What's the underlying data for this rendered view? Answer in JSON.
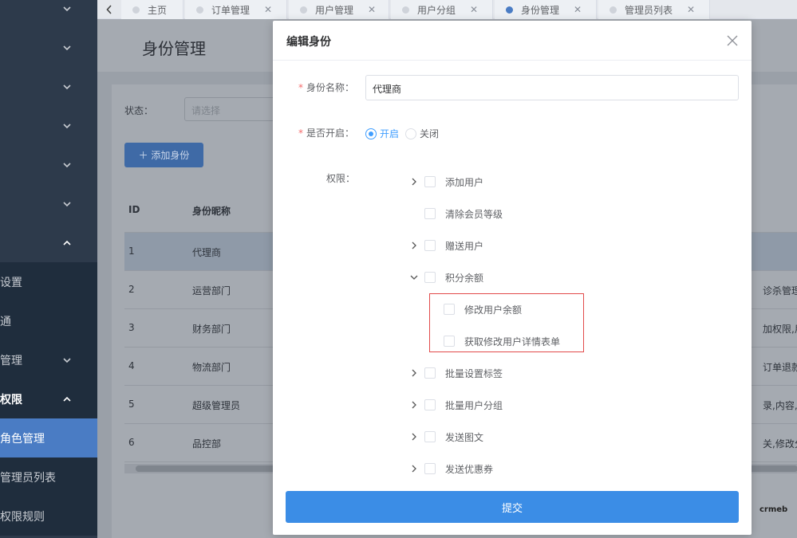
{
  "sidebar": {
    "items": [
      {
        "label": "",
        "expanded": false
      },
      {
        "label": "",
        "expanded": false
      },
      {
        "label": "",
        "expanded": false
      },
      {
        "label": "",
        "expanded": false
      },
      {
        "label": "",
        "expanded": false
      },
      {
        "label": "",
        "expanded": false
      },
      {
        "label": "",
        "expanded": true
      },
      {
        "label": "设置"
      },
      {
        "label": "通"
      },
      {
        "label": "管理",
        "expanded": false
      },
      {
        "label": "权限",
        "expanded": true
      },
      {
        "label": "角色管理",
        "active": true
      },
      {
        "label": "管理员列表"
      },
      {
        "label": "权限规则"
      }
    ]
  },
  "tabs": [
    {
      "label": "主页",
      "active": false
    },
    {
      "label": "订单管理",
      "active": false
    },
    {
      "label": "用户管理",
      "active": false
    },
    {
      "label": "用户分组",
      "active": false
    },
    {
      "label": "身份管理",
      "active": true
    },
    {
      "label": "管理员列表",
      "active": false
    }
  ],
  "page": {
    "title": "身份管理",
    "status_label": "状态：",
    "status_placeholder": "请选择",
    "add_button": "＋ 添加身份",
    "table": {
      "headers": [
        "ID",
        "身份昵称"
      ],
      "rows": [
        {
          "id": "1",
          "name": "代理商",
          "perm": ""
        },
        {
          "id": "2",
          "name": "运营部门",
          "perm": "诊杀管理,财"
        },
        {
          "id": "3",
          "name": "财务部门",
          "perm": "加权限,用户"
        },
        {
          "id": "4",
          "name": "物流部门",
          "perm": "订单退款表"
        },
        {
          "id": "5",
          "name": "超级管理员",
          "perm": "录,内容,文"
        },
        {
          "id": "6",
          "name": "品控部",
          "perm": "关,修改分类"
        }
      ]
    }
  },
  "modal": {
    "title": "编辑身份",
    "name_label": "身份名称：",
    "name_value": "代理商",
    "enabled_label": "是否开启：",
    "radio_on": "开启",
    "radio_off": "关闭",
    "perm_label": "权限：",
    "tree": [
      {
        "label": "添加用户",
        "arrow": "right",
        "level": 0
      },
      {
        "label": "清除会员等级",
        "arrow": "none",
        "level": 0
      },
      {
        "label": "赠送用户",
        "arrow": "right",
        "level": 0
      },
      {
        "label": "积分余额",
        "arrow": "down",
        "level": 0
      },
      {
        "label": "修改用户余额",
        "arrow": "none",
        "level": 1
      },
      {
        "label": "获取修改用户详情表单",
        "arrow": "none",
        "level": 1
      },
      {
        "label": "批量设置标签",
        "arrow": "right",
        "level": 0
      },
      {
        "label": "批量用户分组",
        "arrow": "right",
        "level": 0
      },
      {
        "label": "发送图文",
        "arrow": "right",
        "level": 0
      },
      {
        "label": "发送优惠券",
        "arrow": "right",
        "level": 0
      }
    ],
    "submit": "提交"
  },
  "corner_logo": "crmeb"
}
